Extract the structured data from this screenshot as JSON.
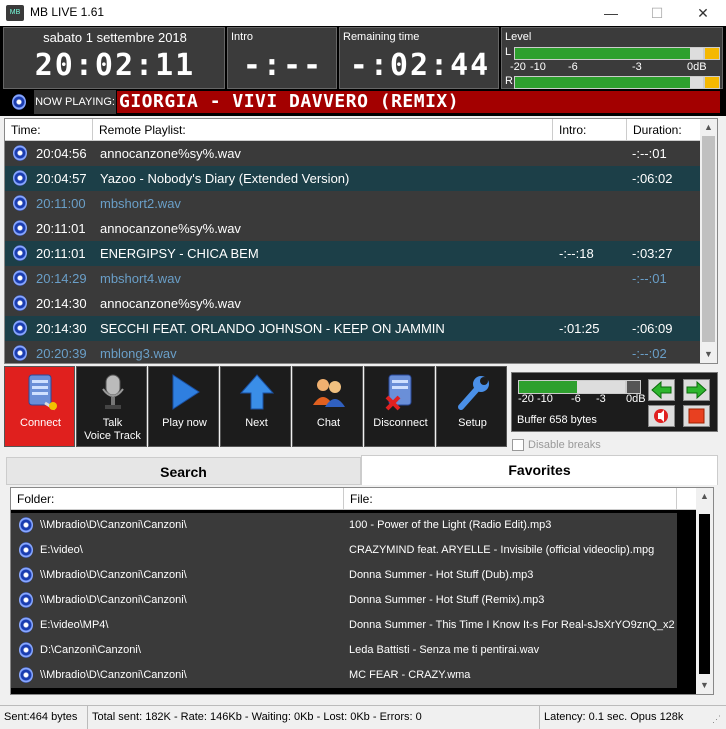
{
  "window": {
    "title": "MB LIVE 1.61",
    "app_icon": "MB",
    "minimize": "—",
    "maximize": "☐",
    "close": "✕"
  },
  "top": {
    "date": "sabato 1 settembre 2018",
    "clock": "20:02:11",
    "intro_label": "Intro",
    "intro_value": "-:--",
    "remaining_label": "Remaining time",
    "remaining_value": "-:02:44",
    "level_label": "Level",
    "channel_l": "L",
    "channel_r": "R",
    "scale": [
      "-20",
      "-10",
      "-6",
      "-3",
      "0dB"
    ],
    "level_l": 0.93,
    "level_r": 0.93
  },
  "now_playing": {
    "label": "NOW PLAYING:",
    "title": "GIORGIA - VIVI DAVVERO (REMIX)"
  },
  "playlist": {
    "headers": {
      "time": "Time:",
      "title": "Remote Playlist:",
      "intro": "Intro:",
      "duration": "Duration:"
    },
    "rows": [
      {
        "time": "20:04:56",
        "title": "annocanzone%sy%.wav",
        "intro": "",
        "duration": "-:--:01"
      },
      {
        "time": "20:04:57",
        "title": "Yazoo - Nobody's Diary (Extended Version)",
        "intro": "",
        "duration": "-:06:02"
      },
      {
        "time": "20:11:00",
        "title": "mbshort2.wav",
        "intro": "",
        "duration": ""
      },
      {
        "time": "20:11:01",
        "title": "annocanzone%sy%.wav",
        "intro": "",
        "duration": ""
      },
      {
        "time": "20:11:01",
        "title": "ENERGIPSY - CHICA BEM",
        "intro": "-:--:18",
        "duration": "-:03:27"
      },
      {
        "time": "20:14:29",
        "title": "mbshort4.wav",
        "intro": "",
        "duration": "-:--:01"
      },
      {
        "time": "20:14:30",
        "title": "annocanzone%sy%.wav",
        "intro": "",
        "duration": ""
      },
      {
        "time": "20:14:30",
        "title": "SECCHI FEAT. ORLANDO JOHNSON - KEEP ON JAMMIN",
        "intro": "-:01:25",
        "duration": "-:06:09"
      },
      {
        "time": "20:20:39",
        "title": "mblong3.wav",
        "intro": "",
        "duration": "-:--:02"
      }
    ]
  },
  "toolbar": {
    "connect": "Connect",
    "talk_line1": "Talk",
    "talk_line2": "Voice Track",
    "play_now": "Play now",
    "next": "Next",
    "chat": "Chat",
    "disconnect": "Disconnect",
    "setup": "Setup"
  },
  "buffer": {
    "scale": [
      "-20",
      "-10",
      "-6",
      "-3",
      "0dB"
    ],
    "level": 0.55,
    "text": "Buffer 658 bytes",
    "disable_breaks": "Disable breaks"
  },
  "tabs": {
    "search": "Search",
    "favorites": "Favorites"
  },
  "favorites": {
    "headers": {
      "folder": "Folder:",
      "file": "File:"
    },
    "rows": [
      {
        "folder": "\\\\Mbradio\\D\\Canzoni\\Canzoni\\",
        "file": "100 - Power of the Light (Radio Edit).mp3"
      },
      {
        "folder": "E:\\video\\",
        "file": "CRAZYMIND feat. ARYELLE - Invisibile (official videoclip).mpg"
      },
      {
        "folder": "\\\\Mbradio\\D\\Canzoni\\Canzoni\\",
        "file": "Donna Summer - Hot Stuff (Dub).mp3"
      },
      {
        "folder": "\\\\Mbradio\\D\\Canzoni\\Canzoni\\",
        "file": "Donna Summer - Hot Stuff (Remix).mp3"
      },
      {
        "folder": "E:\\video\\MP4\\",
        "file": "Donna Summer - This Time I Know It-s For Real-sJsXrYO9znQ_x2..."
      },
      {
        "folder": "D:\\Canzoni\\Canzoni\\",
        "file": "Leda Battisti - Senza me ti pentirai.wav"
      },
      {
        "folder": "\\\\Mbradio\\D\\Canzoni\\Canzoni\\",
        "file": "MC FEAR - CRAZY.wma"
      }
    ]
  },
  "status": {
    "sent": "Sent:464 bytes",
    "stats": "Total sent: 182K - Rate: 146Kb - Waiting: 0Kb - Lost: 0Kb - Errors: 0",
    "latency": "Latency: 0.1 sec. Opus 128k"
  }
}
